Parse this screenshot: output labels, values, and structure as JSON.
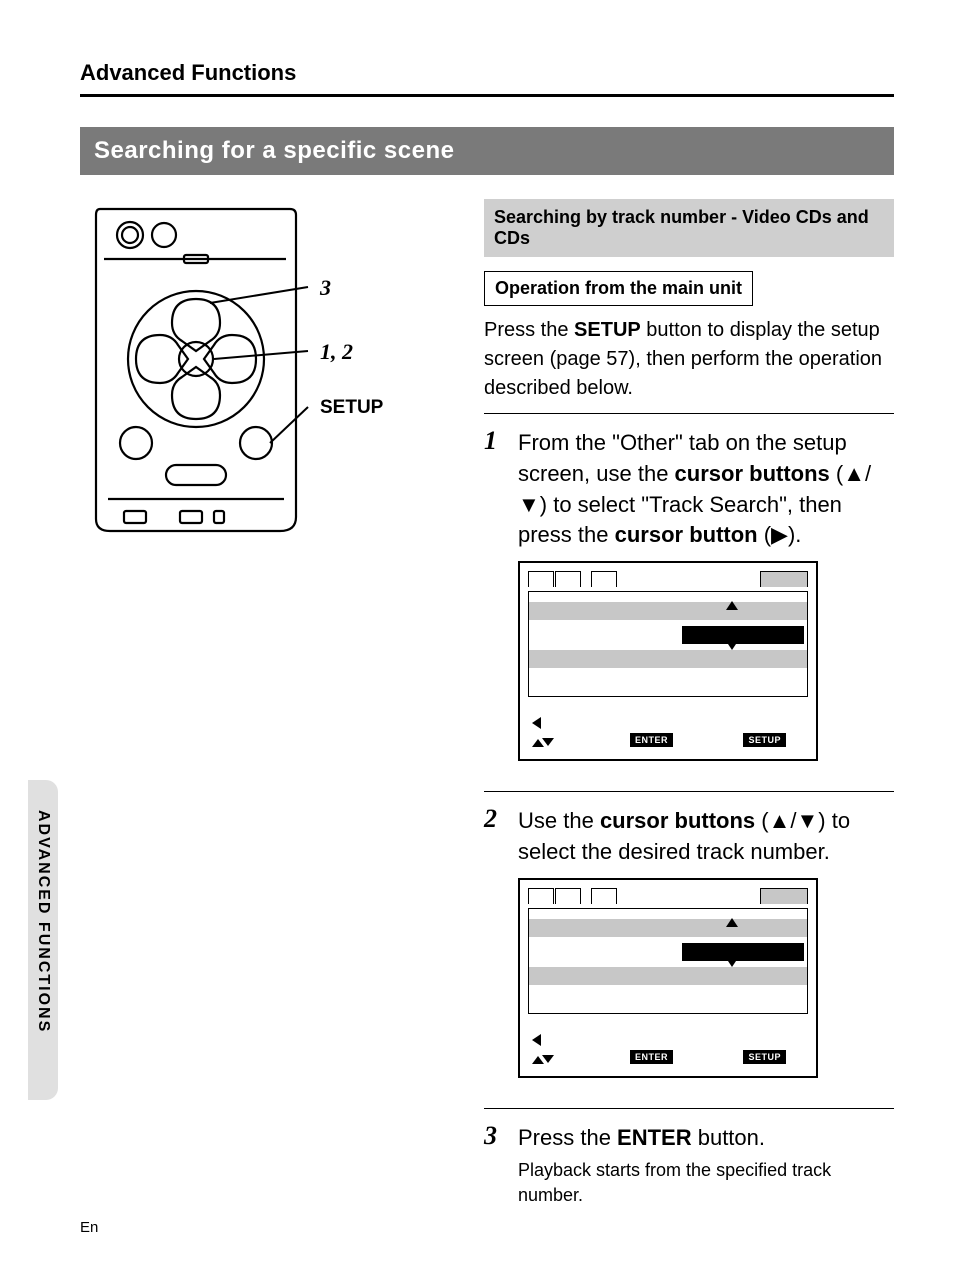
{
  "header": "Advanced Functions",
  "title_bar": "Searching for a specific scene",
  "callouts": {
    "c3": "3",
    "c12": "1, 2",
    "setup": "SETUP"
  },
  "sub1": "Searching by track number - Video CDs and CDs",
  "sub2": "Operation from the main unit",
  "intro": {
    "p1a": "Press the ",
    "p1b": "SETUP",
    "p1c": " button to display the setup screen (page 57), then perform the operation described below."
  },
  "steps": {
    "s1": {
      "num": "1",
      "t1": "From the \"Other\" tab on the setup screen, use the ",
      "t2": "cursor buttons",
      "t3": " (▲/▼) to select \"Track Search\", then press the ",
      "t4": "cursor button",
      "t5": " (▶)."
    },
    "s2": {
      "num": "2",
      "t1": "Use the ",
      "t2": "cursor buttons",
      "t3": " (▲/▼) to select the desired track number."
    },
    "s3": {
      "num": "3",
      "t1": "Press the ",
      "t2": "ENTER",
      "t3": " button.",
      "sub": "Playback starts from the specified track number."
    }
  },
  "chips": {
    "enter": "ENTER",
    "setup": "SETUP"
  },
  "side_tab": "ADVANCED FUNCTIONS",
  "footer": "En"
}
